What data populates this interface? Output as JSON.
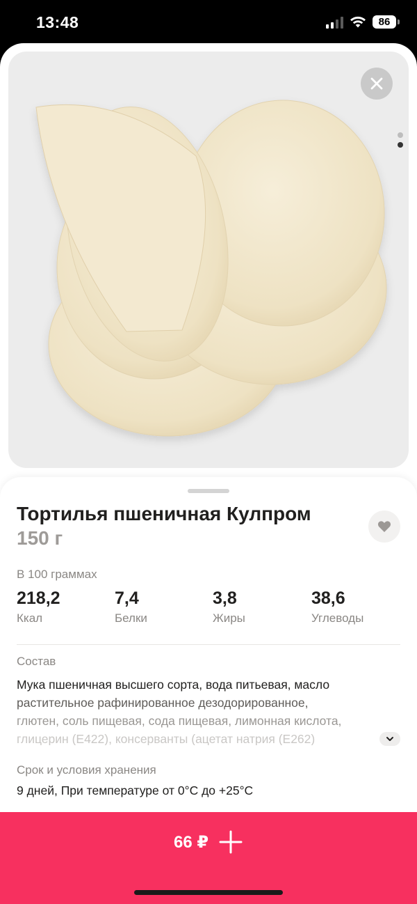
{
  "status_bar": {
    "time": "13:48",
    "battery": "86"
  },
  "product": {
    "title": "Тортилья пшеничная Кулпром",
    "weight": "150 г",
    "per100_label": "В 100 граммах",
    "nutrients": [
      {
        "value": "218,2",
        "label": "Ккал"
      },
      {
        "value": "7,4",
        "label": "Белки"
      },
      {
        "value": "3,8",
        "label": "Жиры"
      },
      {
        "value": "38,6",
        "label": "Углеводы"
      }
    ],
    "composition_label": "Состав",
    "composition_lines": [
      "Мука пшеничная высшего сорта, вода питьевая, масло",
      "растительное рафинированное дезодорированное,",
      "глютен, соль пищевая, сода пищевая, лимонная кислота,",
      "глицерин (Е422), консерванты (ацетат натрия (Е262)"
    ],
    "storage_label": "Срок и условия хранения",
    "storage_value": "9 дней, При температуре от 0°C до +25°C"
  },
  "buy_button": {
    "price": "66 ₽"
  },
  "icons": {
    "close": "close-icon",
    "favorite": "heart-icon",
    "expand": "chevron-down-icon",
    "add": "plus-icon"
  },
  "colors": {
    "accent": "#f7305f",
    "muted": "#8a8784",
    "text": "#21201f"
  }
}
